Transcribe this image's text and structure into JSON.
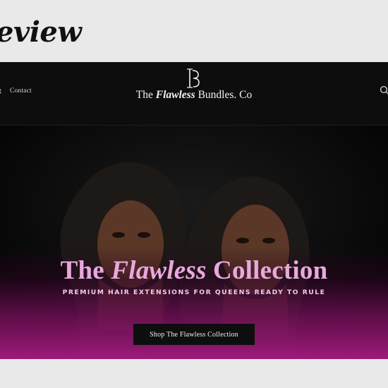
{
  "overlay": {
    "label": "eview"
  },
  "header": {
    "nav": [
      {
        "label": "og"
      },
      {
        "label": "Contact"
      }
    ],
    "brand": {
      "part1": "The ",
      "part2": "Flawless",
      "part3": " Bundles. Co"
    },
    "icons": {
      "search": "search-icon",
      "monogram": "monogram-logo"
    }
  },
  "hero": {
    "title": {
      "part1": "The ",
      "part2": "Flawless",
      "part3": " Collection"
    },
    "subtitle": "PREMIUM HAIR EXTENSIONS FOR QUEENS READY TO RULE",
    "cta_label": "Shop The Flawless Collection"
  },
  "colors": {
    "page_bg": "#e9e9e9",
    "header_bg": "#0d0d0d",
    "hero_bg": "#070707",
    "accent_pink": "#e9a8dd",
    "magenta": "#9c1a7a",
    "button_bg": "#0e0e0e"
  }
}
